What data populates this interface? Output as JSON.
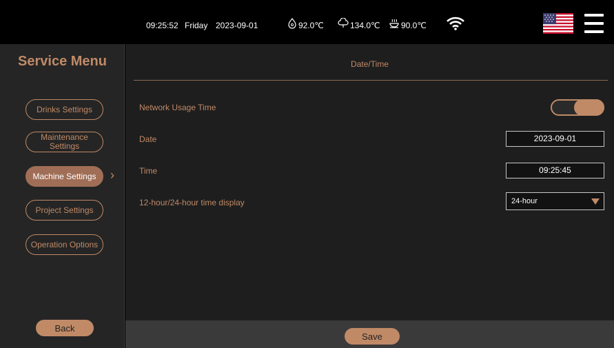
{
  "status_bar": {
    "time": "09:25:52",
    "day": "Friday",
    "date": "2023-09-01",
    "temp_1": "92.0℃",
    "temp_1_icon": "drop-temperature-icon",
    "temp_2": "134.0℃",
    "temp_2_icon": "steam-temperature-icon",
    "temp_3": "90.0℃",
    "temp_3_icon": "cup-temperature-icon",
    "wifi_icon": "wifi-icon",
    "language_icon": "us-flag-icon",
    "menu_icon": "hamburger-menu-icon"
  },
  "sidebar": {
    "title": "Service Menu",
    "items": [
      {
        "label": "Drinks Settings"
      },
      {
        "label": "Maintenance Settings"
      },
      {
        "label": "Machine Settings"
      },
      {
        "label": "Project Settings"
      },
      {
        "label": "Operation Options"
      }
    ],
    "active_index": 2,
    "back_label": "Back"
  },
  "main": {
    "title": "Date/Time",
    "network_usage_label": "Network Usage Time",
    "network_usage_on": true,
    "date_label": "Date",
    "date_value": "2023-09-01",
    "time_label": "Time",
    "time_value": "09:25:45",
    "format_label": "12-hour/24-hour time display",
    "format_value": "24-hour"
  },
  "footer": {
    "save_label": "Save"
  },
  "colors": {
    "accent": "#c08a67",
    "active": "#a06e56",
    "background": "#1e1e1e",
    "sidebar": "#252525",
    "footer": "#3a3a3a"
  }
}
